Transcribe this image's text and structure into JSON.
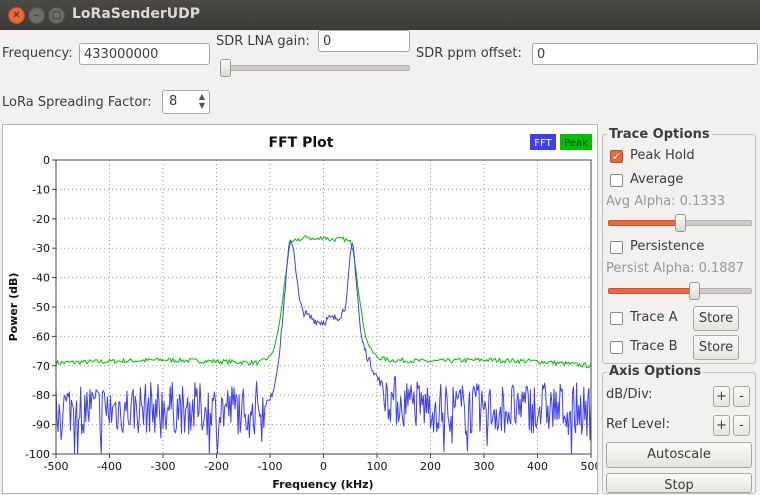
{
  "window": {
    "title": "LoRaSenderUDP"
  },
  "controls": {
    "frequency_label": "Frequency:",
    "frequency_value": "433000000",
    "lna_label": "SDR LNA gain:",
    "lna_value": "0",
    "ppm_label": "SDR ppm offset:",
    "ppm_value": "0",
    "sf_label": "LoRa Spreading Factor:",
    "sf_value": "8"
  },
  "trace_options": {
    "title": "Trace Options",
    "peak_hold": {
      "label": "Peak Hold",
      "checked": true
    },
    "average": {
      "label": "Average",
      "checked": false
    },
    "avg_alpha_label": "Avg Alpha: 0.1333",
    "avg_alpha_level": 0.5,
    "persistence": {
      "label": "Persistence",
      "checked": false
    },
    "persist_alpha_label": "Persist Alpha: 0.1887",
    "persist_alpha_level": 0.6,
    "trace_a": {
      "label": "Trace A",
      "store": "Store"
    },
    "trace_b": {
      "label": "Trace B",
      "store": "Store"
    }
  },
  "axis_options": {
    "title": "Axis Options",
    "db_div_label": "dB/Div:",
    "ref_level_label": "Ref Level:",
    "plus": "+",
    "minus": "-",
    "autoscale": "Autoscale",
    "stop": "Stop"
  },
  "colors": {
    "fft": "#4040f0",
    "peak": "#00c000",
    "accent": "#e9683f"
  },
  "chart_data": {
    "type": "line",
    "title": "FFT Plot",
    "xlabel": "Frequency (kHz)",
    "ylabel": "Power (dB)",
    "xlim": [
      -500,
      500
    ],
    "ylim": [
      -100,
      0
    ],
    "xticks": [
      -500,
      -400,
      -300,
      -200,
      -100,
      0,
      100,
      200,
      300,
      400,
      500
    ],
    "yticks": [
      0,
      -10,
      -20,
      -30,
      -40,
      -50,
      -60,
      -70,
      -80,
      -90,
      -100
    ],
    "grid": true,
    "legend": "top-right",
    "series": [
      {
        "name": "FFT",
        "color": "#4040f0",
        "x": [
          -500,
          -400,
          -300,
          -200,
          -130,
          -100,
          -90,
          -80,
          -70,
          -65,
          -60,
          -55,
          -50,
          -45,
          -40,
          -30,
          -20,
          -10,
          0,
          10,
          20,
          30,
          35,
          40,
          45,
          50,
          55,
          60,
          70,
          80,
          90,
          100,
          130,
          200,
          300,
          400,
          500
        ],
        "y": [
          -84,
          -85,
          -84,
          -85,
          -84,
          -82,
          -75,
          -62,
          -40,
          -30,
          -27,
          -31,
          -40,
          -48,
          -51,
          -53,
          -54,
          -55,
          -55,
          -54,
          -54,
          -53,
          -52,
          -50,
          -44,
          -33,
          -28,
          -38,
          -60,
          -66,
          -70,
          -74,
          -82,
          -84,
          -85,
          -84,
          -85
        ]
      },
      {
        "name": "Peak",
        "color": "#00c000",
        "x": [
          -500,
          -400,
          -300,
          -200,
          -120,
          -100,
          -90,
          -80,
          -70,
          -65,
          -60,
          -55,
          -50,
          -40,
          -30,
          -20,
          -10,
          0,
          10,
          20,
          30,
          40,
          50,
          55,
          60,
          70,
          80,
          90,
          100,
          120,
          200,
          300,
          400,
          500
        ],
        "y": [
          -69,
          -68.5,
          -68,
          -68.5,
          -69,
          -67,
          -63,
          -53,
          -38,
          -31,
          -28,
          -28,
          -27,
          -27,
          -26,
          -27,
          -27,
          -26,
          -27,
          -27,
          -27,
          -27,
          -28,
          -30,
          -36,
          -51,
          -61,
          -65,
          -67,
          -68,
          -68.5,
          -68,
          -68.5,
          -70
        ]
      }
    ]
  }
}
